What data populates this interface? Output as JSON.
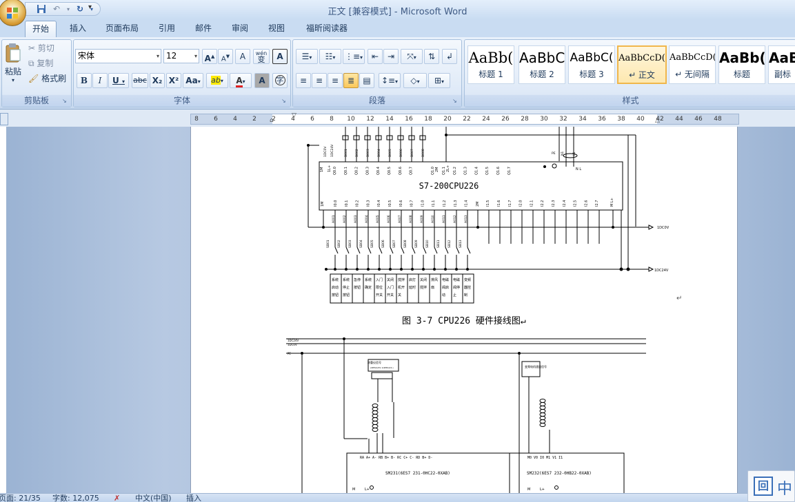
{
  "window": {
    "title": "正文 [兼容模式] - Microsoft Word"
  },
  "tabs": [
    "开始",
    "插入",
    "页面布局",
    "引用",
    "邮件",
    "审阅",
    "视图",
    "福昕阅读器"
  ],
  "clipboard": {
    "paste": "粘贴",
    "cut": "剪切",
    "copy": "复制",
    "format_painter": "格式刷",
    "label": "剪贴板"
  },
  "font": {
    "name": "宋体",
    "size": "12",
    "grow": "A",
    "shrink": "A",
    "clear": "A",
    "phonetic": "wén",
    "phonetic_char": "变",
    "border": "A",
    "bold": "B",
    "italic": "I",
    "underline": "U",
    "strike": "abc",
    "sub": "X₂",
    "sup": "X²",
    "case": "Aa",
    "highlight": "ab",
    "color": "A",
    "shade": "A",
    "enclose": "字",
    "label": "字体"
  },
  "paragraph": {
    "label": "段落"
  },
  "styles": {
    "label": "样式",
    "items": [
      {
        "sample": "AaBb(",
        "name": "标题 1"
      },
      {
        "sample": "AaBbC",
        "name": "标题 2"
      },
      {
        "sample": "AaBbC(",
        "name": "标题 3"
      },
      {
        "sample": "AaBbCcD(",
        "name": "↵ 正文"
      },
      {
        "sample": "AaBbCcD(",
        "name": "↵ 无间隔"
      },
      {
        "sample": "AaBb(",
        "name": "标题"
      },
      {
        "sample": "AaB",
        "name": "副标"
      }
    ]
  },
  "ruler": {
    "ticks": [
      "8",
      "6",
      "4",
      "2",
      "2",
      "4",
      "6",
      "8",
      "10",
      "12",
      "14",
      "16",
      "18",
      "20",
      "22",
      "24",
      "26",
      "28",
      "30",
      "32",
      "34",
      "36",
      "38",
      "40",
      "42",
      "44",
      "46",
      "48"
    ]
  },
  "document": {
    "plc_label": "S7-200CPU226",
    "caption": "图 3-7 CPU226 硬件接线图↵",
    "bus_labels": {
      "dc0v": "1DC0V",
      "dc24v": "1DC24V",
      "pe": "PE"
    },
    "module1": "SM231(6ES7 231-0HC22-0XAB)",
    "module2": "SM232(6ES7 232-0HB22-0XAB)",
    "module1_terminals": "RA  A+  A-     RB   B+  B-     RC  C+  C-   RD  B+  D-",
    "module2_terminals": "M0   V0   I0    M1   V1   I1",
    "terminal_labels": [
      "系统启动按钮",
      "系统停止按钮",
      "急停按钮",
      "系统确定",
      "入门限位开关",
      "关闭入门开关",
      "搅拌机开关",
      "启打延时",
      "关闭搅拌",
      "排风扇",
      "电磁阀启动",
      "电磁阀停止",
      "变频器控制"
    ],
    "output_labels": [
      "B001",
      "B002",
      "B003",
      "B004",
      "B005",
      "B006",
      "B007",
      "B008"
    ],
    "input_labels": [
      "A001",
      "A002",
      "A003",
      "A004",
      "A005",
      "A006",
      "A007",
      "A008",
      "A009",
      "A010",
      "A011",
      "A012",
      "A013"
    ],
    "input_buttons": [
      "SB01",
      "SB02",
      "SB03",
      "SB04",
      "SB05",
      "SB06",
      "SB07",
      "SB08",
      "SB09",
      "SB10",
      "SB11",
      "SB12",
      "SB13"
    ],
    "q_pins": [
      "Q0.0",
      "Q0.1",
      "Q0.2",
      "Q0.3",
      "Q0.4",
      "Q0.5",
      "Q0.6",
      "Q0.7",
      "",
      "Q1.0",
      "Q1.1",
      "Q1.2",
      "Q1.3",
      "Q1.4",
      "Q1.5",
      "Q1.6",
      "Q1.7"
    ],
    "i_pins": [
      "I0.0",
      "I0.1",
      "I0.2",
      "I0.3",
      "I0.4",
      "I0.5",
      "I0.6",
      "I0.7",
      "I1.0",
      "I1.1",
      "I1.2",
      "I1.3",
      "I1.4",
      "",
      "I1.5",
      "I1.6",
      "I1.7",
      "I2.0",
      "I2.1",
      "I2.2",
      "I2.3",
      "I2.4",
      "I2.5",
      "I2.6",
      "I2.7"
    ],
    "sensor1_title": "称重仪信号",
    "sensor1_sub": "(4PPLX/2S 1/4PPLX/2-)",
    "sensor2_title": "变频电机速度信号"
  },
  "statusbar": {
    "page": "页面: 21/35",
    "words": "字数: 12,075",
    "lang": "中文(中国)",
    "mode": "插入"
  },
  "ime": {
    "icon": "回",
    "lang": "中"
  }
}
